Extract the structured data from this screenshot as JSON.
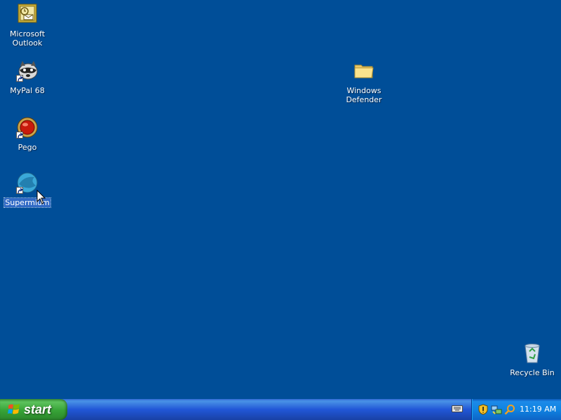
{
  "desktop": {
    "background_color": "#004e98",
    "icons": [
      {
        "label": "Microsoft\nOutlook",
        "icon": "outlook-icon",
        "shortcut": false
      },
      {
        "label": "MyPal 68",
        "icon": "mypal-raccoon-icon",
        "shortcut": true
      },
      {
        "label": "Pego",
        "icon": "pego-icon",
        "shortcut": true
      },
      {
        "label": "Supermium",
        "icon": "supermium-icon",
        "shortcut": true,
        "selected": true
      },
      {
        "label": "Windows\nDefender",
        "icon": "folder-icon",
        "shortcut": false
      },
      {
        "label": "Recycle Bin",
        "icon": "recycle-bin-icon",
        "shortcut": false
      }
    ]
  },
  "taskbar": {
    "start_label": "start",
    "start_icon": "windows-logo-icon",
    "input_indicator_icon": "keyboard-icon",
    "tray_icons": [
      "security-shield-icon",
      "network-icon",
      "search-icon"
    ],
    "clock": "11:19 AM"
  }
}
